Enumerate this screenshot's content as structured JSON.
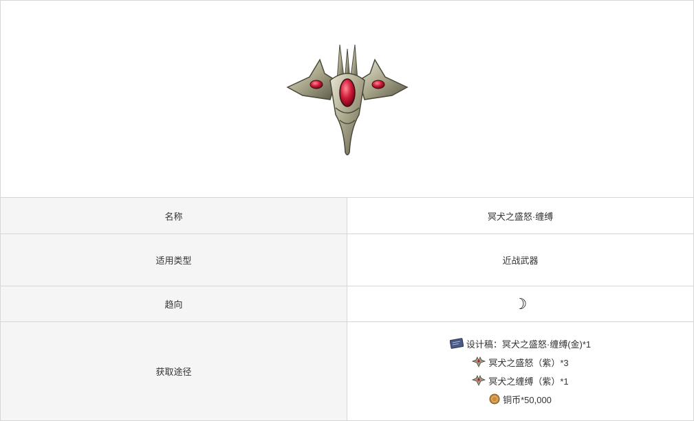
{
  "hero": {
    "icon": "wolf-crest-emblem-icon"
  },
  "rows": [
    {
      "label": "名称",
      "value": "冥犬之盛怒·缠缚"
    },
    {
      "label": "适用类型",
      "value": "近战武器"
    },
    {
      "label": "趋向",
      "value": "☽"
    },
    {
      "label": "获取途径"
    }
  ],
  "sources": [
    {
      "icon": "blueprint-icon",
      "text": "设计稿：冥犬之盛怒·缠缚(金)*1"
    },
    {
      "icon": "crest-purple-icon",
      "text": "冥犬之盛怒（紫）*3"
    },
    {
      "icon": "crest-purple-icon",
      "text": "冥犬之缠缚（紫）*1"
    },
    {
      "icon": "copper-coin-icon",
      "text": "铜币*50,000"
    }
  ],
  "colors": {
    "border": "#d6d6d6",
    "label_bg": "#f5f5f5",
    "gem_red": "#c8102e",
    "metal": "#b8b59a"
  }
}
